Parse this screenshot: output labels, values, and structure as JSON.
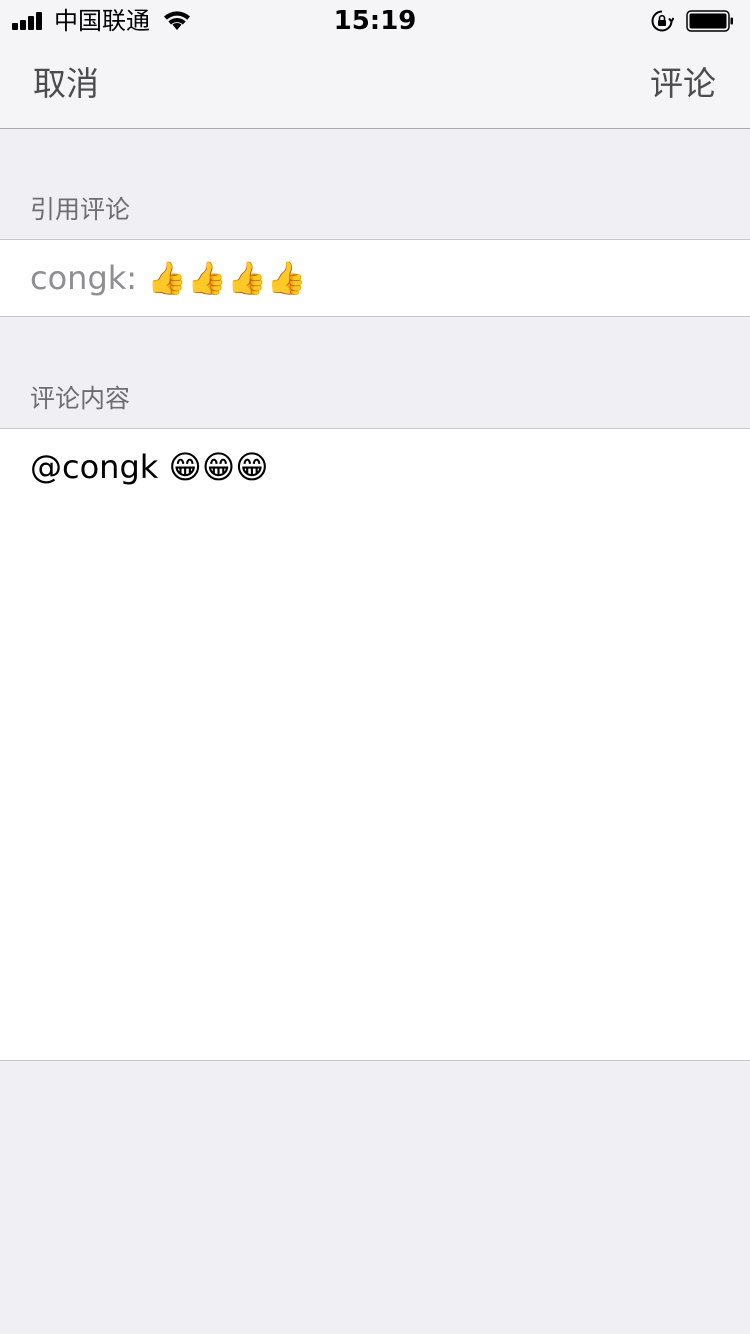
{
  "status_bar": {
    "carrier": "中国联通",
    "time": "15:19"
  },
  "nav": {
    "cancel_label": "取消",
    "submit_label": "评论"
  },
  "quote_section": {
    "header": "引用评论",
    "text": "congk: 👍👍👍👍"
  },
  "content_section": {
    "header": "评论内容",
    "text": "@congk 😁😁😁"
  },
  "colors": {
    "background": "#efeff4",
    "bar": "#f5f5f7",
    "nav_text": "#4c4c4c",
    "section_header_text": "#6d6d72",
    "quote_text": "#8e8e93",
    "separator": "#c8c7cc"
  }
}
